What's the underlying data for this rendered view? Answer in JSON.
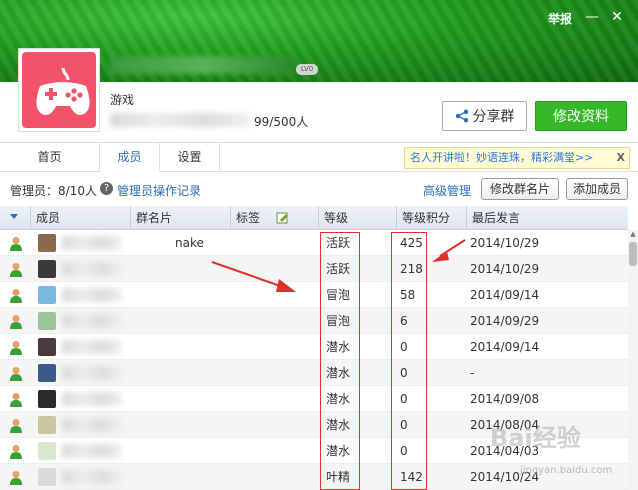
{
  "header": {
    "report": "举报",
    "min_glyph": "—",
    "close_glyph": "✕",
    "level_badge": "LV0",
    "category": "游戏",
    "member_count": "99/500人",
    "share_label": "分享群",
    "edit_label": "修改资料"
  },
  "tabs": [
    {
      "label": "首页"
    },
    {
      "label": "成员"
    },
    {
      "label": "设置"
    }
  ],
  "promo": {
    "text": "名人开讲啦！妙语连珠，精彩满堂>>",
    "close": "X"
  },
  "admin_bar": {
    "label": "管理员：8/10人",
    "help": "?",
    "log_link": "管理员操作记录",
    "advanced": "高级管理",
    "edit_card": "修改群名片",
    "add_member": "添加成员"
  },
  "columns": [
    "成员",
    "群名片",
    "标签",
    "等级",
    "等级积分",
    "最后发言"
  ],
  "rows": [
    {
      "card": "nake",
      "level": "活跃",
      "points": "425",
      "last": "2014/10/29",
      "thumb": "#8a6a4a"
    },
    {
      "card": "",
      "level": "活跃",
      "points": "218",
      "last": "2014/10/29",
      "thumb": "#3a3a3a"
    },
    {
      "card": "",
      "level": "冒泡",
      "points": "58",
      "last": "2014/09/14",
      "thumb": "#7ab8e0"
    },
    {
      "card": "",
      "level": "冒泡",
      "points": "6",
      "last": "2014/09/29",
      "thumb": "#9ac49a"
    },
    {
      "card": "",
      "level": "潜水",
      "points": "0",
      "last": "2014/09/14",
      "thumb": "#4a3a3a"
    },
    {
      "card": "",
      "level": "潜水",
      "points": "0",
      "last": "-",
      "thumb": "#3a5a8a"
    },
    {
      "card": "",
      "level": "潜水",
      "points": "0",
      "last": "2014/09/08",
      "thumb": "#2a2a2a"
    },
    {
      "card": "",
      "level": "潜水",
      "points": "0",
      "last": "2014/08/04",
      "thumb": "#c8c8a0"
    },
    {
      "card": "",
      "level": "潜水",
      "points": "0",
      "last": "2014/04/03",
      "thumb": "#d8e8d0"
    },
    {
      "card": "",
      "level": "叶精",
      "points": "142",
      "last": "2014/10/24",
      "thumb": "#dadada"
    }
  ],
  "watermark": {
    "brand": "Bai经验",
    "url": "jingyan.baidu.com"
  },
  "colors": {
    "brand_green": "#37b82a",
    "link_blue": "#2a6db5",
    "annotation_red": "#e0302a"
  }
}
